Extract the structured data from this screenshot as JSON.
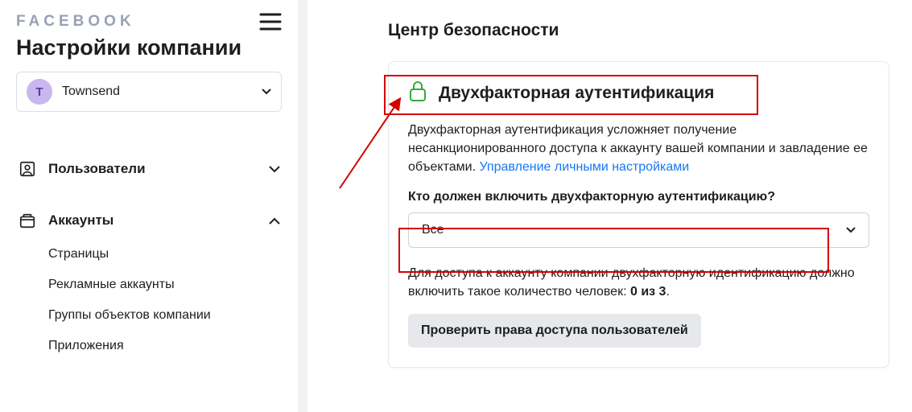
{
  "sidebar": {
    "brand": "FACEBOOK",
    "settings_title": "Настройки компании",
    "company": {
      "initial": "T",
      "name": "Townsend"
    },
    "nav": {
      "users": {
        "label": "Пользователи"
      },
      "accounts": {
        "label": "Аккаунты",
        "sub": {
          "pages": "Страницы",
          "ad_accounts": "Рекламные аккаунты",
          "asset_groups": "Группы объектов компании",
          "apps": "Приложения"
        }
      }
    }
  },
  "main": {
    "page_title": "Центр безопасности",
    "card": {
      "title": "Двухфакторная аутентификация",
      "description": "Двухфакторная аутентификация усложняет получение несанкционированного доступа к аккаунту вашей компании и завладение ее объектами. ",
      "link_text": "Управление личными настройками",
      "question": "Кто должен включить двухфакторную аутентификацию?",
      "select_value": "Все",
      "info_prefix": "Для доступа к аккаунту компании двухфакторную идентификацию должно включить такое количество человек: ",
      "info_bold": "0 из 3",
      "info_suffix": ".",
      "button": "Проверить права доступа пользователей"
    }
  }
}
